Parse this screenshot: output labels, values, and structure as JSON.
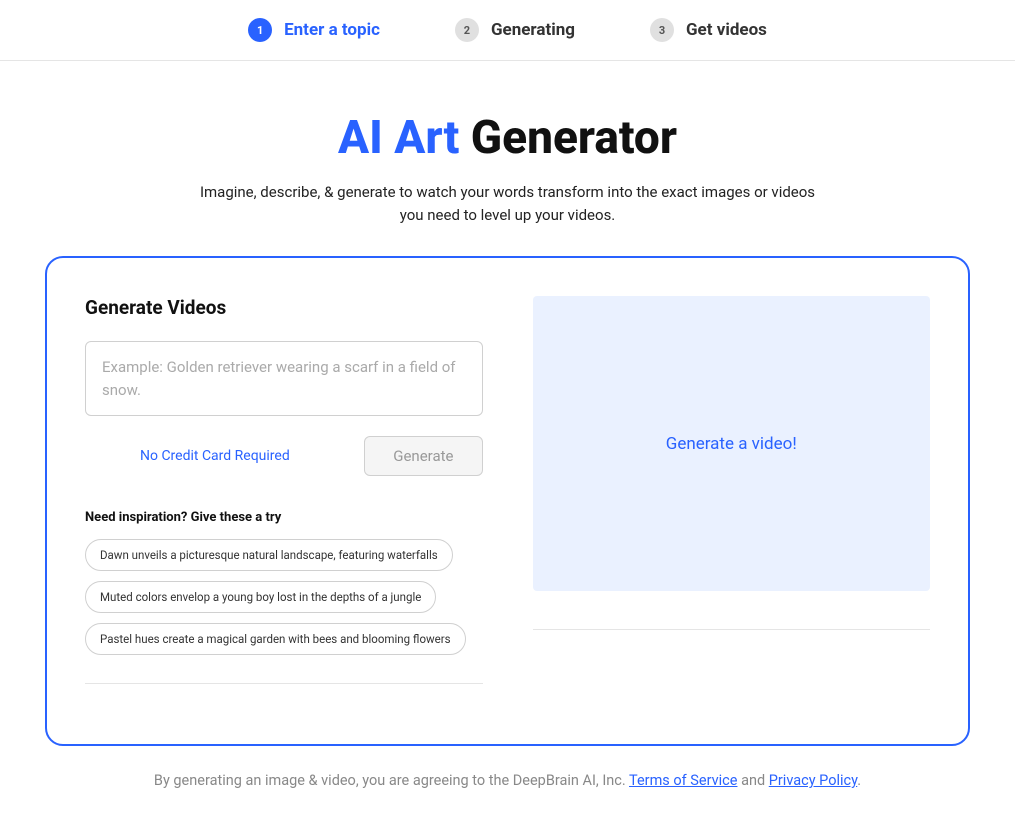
{
  "stepper": {
    "steps": [
      {
        "num": "1",
        "label": "Enter a topic",
        "active": true
      },
      {
        "num": "2",
        "label": "Generating",
        "active": false
      },
      {
        "num": "3",
        "label": "Get videos",
        "active": false
      }
    ]
  },
  "hero": {
    "title_accent": "AI Art",
    "title_rest": " Generator",
    "subtitle": "Imagine, describe, & generate to watch your words transform into the exact images or videos you need to level up your videos."
  },
  "panel": {
    "section_title": "Generate Videos",
    "prompt_placeholder": "Example: Golden retriever wearing a scarf in a field of snow.",
    "no_cc_text": "No Credit Card Required",
    "generate_btn": "Generate",
    "inspiration_title": "Need inspiration? Give these a try",
    "chips": [
      "Dawn unveils a picturesque natural landscape, featuring waterfalls",
      "Muted colors envelop a young boy lost in the depths of a jungle",
      "Pastel hues create a magical garden with bees and blooming flowers"
    ],
    "preview_text": "Generate a video!"
  },
  "footer": {
    "prefix": "By generating an image & video, you are agreeing to the DeepBrain AI, Inc. ",
    "tos": "Terms of Service",
    "mid": " and ",
    "privacy": "Privacy Policy",
    "suffix": "."
  }
}
